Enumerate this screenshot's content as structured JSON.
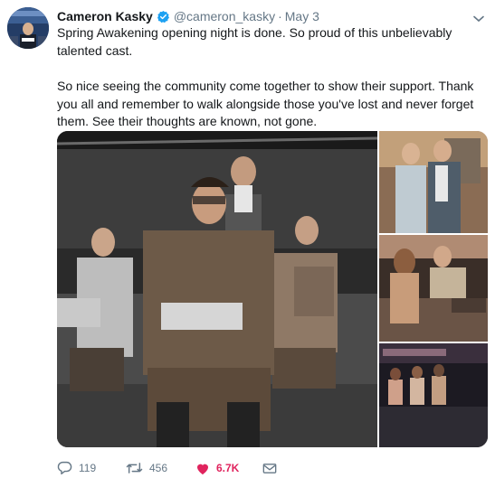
{
  "tweet": {
    "author_name": "Cameron Kasky",
    "handle": "@cameron_kasky",
    "separator": "·",
    "date": "May 3",
    "paragraphs": [
      "Spring Awakening opening night is done. So proud of this unbelievably talented cast.",
      "So nice seeing the community come together to show their support. Thank you all and remember to walk alongside those you've lost and never forget them. See their thoughts are known, not gone."
    ],
    "stats": {
      "replies": "119",
      "retweets": "456",
      "likes": "6.7K"
    }
  },
  "icons": {
    "verified": "verified-badge-icon",
    "caret": "chevron-down-icon",
    "reply": "reply-bubble-icon",
    "retweet": "retweet-icon",
    "like": "heart-icon",
    "dm": "envelope-icon"
  },
  "colors": {
    "text": "#14171a",
    "muted": "#657786",
    "verified": "#1da1f2",
    "like_active": "#e0245e"
  }
}
